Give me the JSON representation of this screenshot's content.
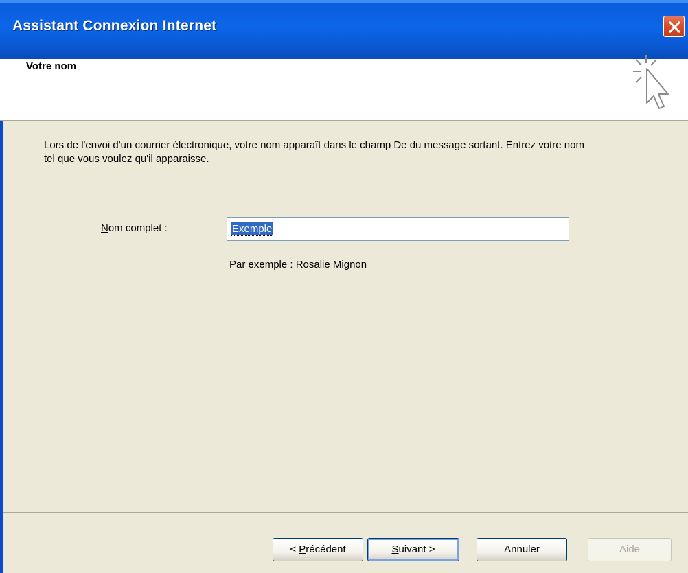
{
  "window": {
    "title": "Assistant Connexion Internet"
  },
  "header": {
    "title": "Votre nom",
    "icon": "wizard-cursor-icon"
  },
  "body": {
    "instructions": "Lors de l'envoi d'un courrier électronique, votre nom apparaît dans le champ De du message sortant. Entrez votre nom tel que vous voulez qu'il apparaisse.",
    "name_label_mnemonic": "N",
    "name_label_rest": "om complet :",
    "name_value": "Exemple",
    "hint": "Par exemple : Rosalie Mignon"
  },
  "buttons": {
    "prev_prefix": "< ",
    "prev_mnemonic": "P",
    "prev_rest": "récédent",
    "next_mnemonic": "S",
    "next_rest": "uivant >",
    "cancel": "Annuler",
    "help": "Aide",
    "help_enabled": false
  },
  "colors": {
    "titlebar": "#0a5fd9",
    "dialog_bg": "#ece9d8",
    "selection": "#316ac5",
    "close": "#d9532e"
  }
}
